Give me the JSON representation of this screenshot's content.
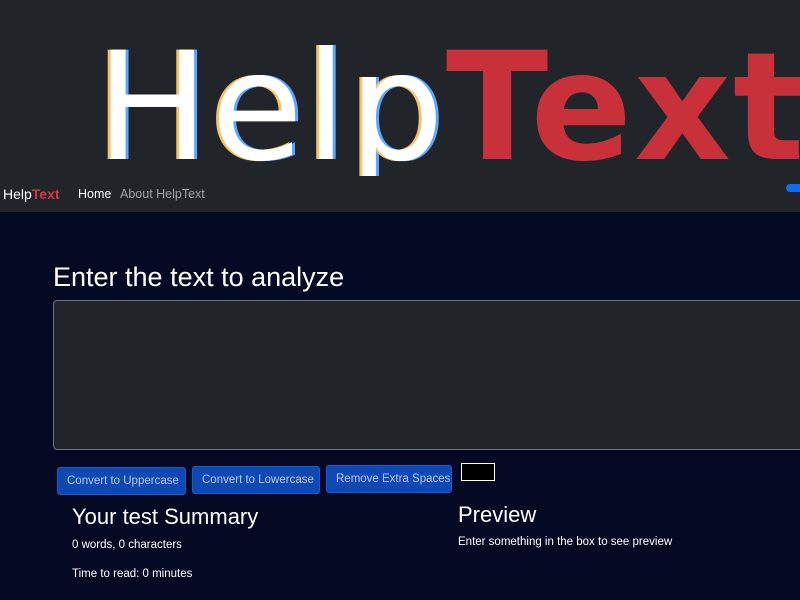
{
  "logo": {
    "part1": "Help",
    "part2": "Text"
  },
  "navbar": {
    "brand_part1": "Help",
    "brand_part2": "Text",
    "home": "Home",
    "about": "About HelpText"
  },
  "main": {
    "heading": "Enter the text to analyze",
    "textarea_value": "",
    "buttons": {
      "uppercase": "Convert to Uppercase",
      "lowercase": "Convert to Lowercase",
      "remove_spaces": "Remove Extra Spaces"
    }
  },
  "summary": {
    "title": "Your test Summary",
    "words_chars": "0 words, 0 characters",
    "time_to_read": "Time to read: 0 minutes"
  },
  "preview": {
    "title": "Preview",
    "text": "Enter something in the box to see preview"
  },
  "colors": {
    "page_bg": "#050a24",
    "navbar_bg": "#212529",
    "brand_accent": "#dc3545",
    "button_bg": "#0d49b5",
    "color_swatch": "#000000"
  }
}
